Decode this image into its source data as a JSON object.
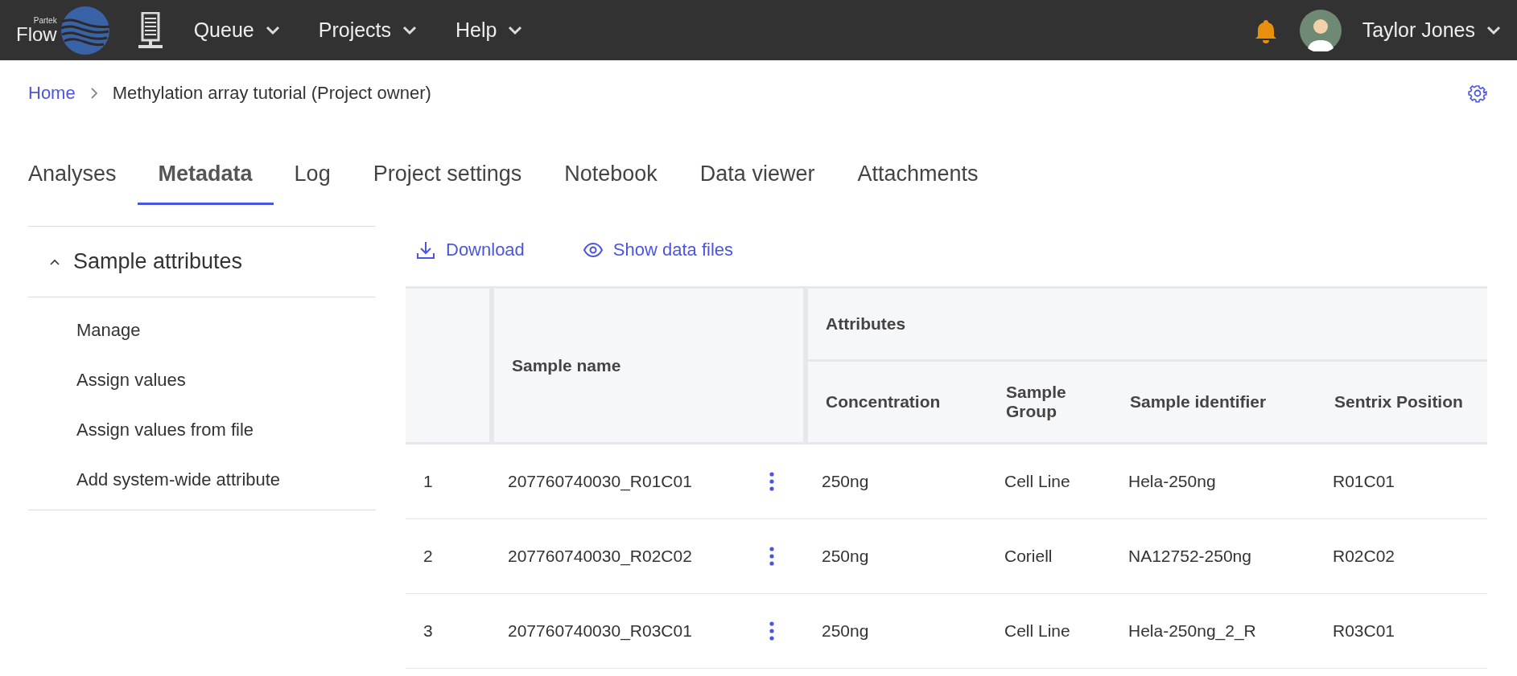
{
  "topbar": {
    "logo": {
      "brand": "Partek",
      "product": "Flow"
    },
    "menus": [
      {
        "label": "Queue"
      },
      {
        "label": "Projects"
      },
      {
        "label": "Help"
      }
    ],
    "user": {
      "name": "Taylor Jones"
    }
  },
  "breadcrumb": [
    {
      "label": "Home",
      "kind": "link"
    },
    {
      "label": "Methylation array tutorial (Project owner)",
      "kind": "current"
    }
  ],
  "tabs": [
    {
      "label": "Analyses",
      "selected": false
    },
    {
      "label": "Metadata",
      "selected": true
    },
    {
      "label": "Log",
      "selected": false
    },
    {
      "label": "Project settings",
      "selected": false
    },
    {
      "label": "Notebook",
      "selected": false
    },
    {
      "label": "Data viewer",
      "selected": false
    },
    {
      "label": "Attachments",
      "selected": false
    }
  ],
  "sidebar": {
    "section": {
      "label": "Sample attributes",
      "expanded": true,
      "items": [
        {
          "label": "Manage"
        },
        {
          "label": "Assign values"
        },
        {
          "label": "Assign values from file"
        },
        {
          "label": "Add system-wide attribute"
        }
      ]
    }
  },
  "toolbar": [
    {
      "label": "Download",
      "kind": "download"
    },
    {
      "label": "Show data files",
      "kind": "show"
    }
  ],
  "table": {
    "name_column": "Sample name",
    "group_header": "Attributes",
    "columns": [
      "Concentration",
      "Sample Group",
      "Sample identifier",
      "Sentrix Position"
    ],
    "rows": [
      {
        "index": "1",
        "name": "207760740030_R01C01",
        "cells": [
          "250ng",
          "Cell Line",
          "Hela-250ng",
          "R01C01"
        ]
      },
      {
        "index": "2",
        "name": "207760740030_R02C02",
        "cells": [
          "250ng",
          "Coriell",
          "NA12752-250ng",
          "R02C02"
        ]
      },
      {
        "index": "3",
        "name": "207760740030_R03C01",
        "cells": [
          "250ng",
          "Cell Line",
          "Hela-250ng_2_R",
          "R03C01"
        ]
      }
    ]
  }
}
